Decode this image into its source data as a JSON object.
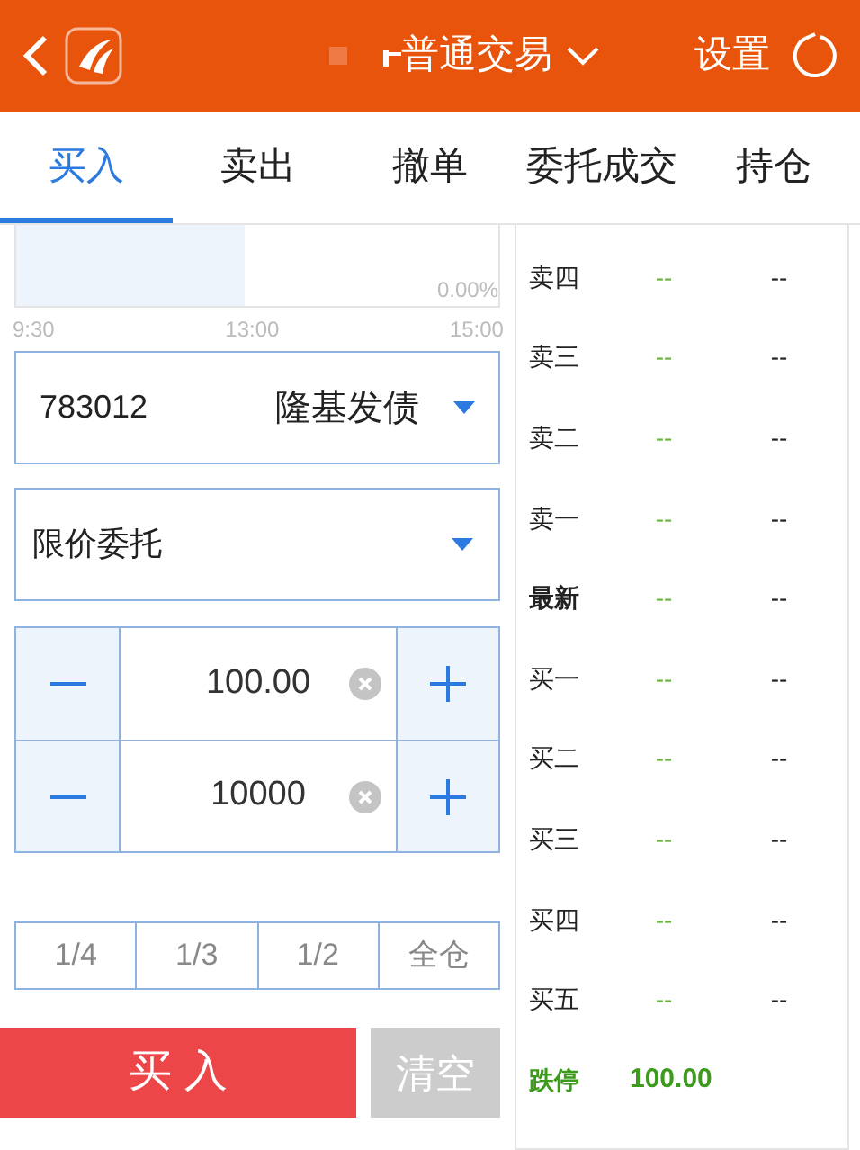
{
  "header": {
    "title": "普通交易",
    "settings": "设置"
  },
  "tabs": [
    {
      "label": "买入",
      "selected": true
    },
    {
      "label": "卖出",
      "selected": false
    },
    {
      "label": "撤单",
      "selected": false
    },
    {
      "label": "委托成交",
      "selected": false
    },
    {
      "label": "持仓",
      "selected": false
    }
  ],
  "chart": {
    "change": "0.00%",
    "times": [
      "9:30",
      "13:00",
      "15:00"
    ]
  },
  "stock": {
    "code": "783012",
    "name": "隆基发债"
  },
  "order_type": "限价委托",
  "price": {
    "value": "100.00"
  },
  "quantity": {
    "value": "10000"
  },
  "ratios": [
    "1/4",
    "1/3",
    "1/2",
    "全仓"
  ],
  "buy_button": "买 入",
  "clear_button": "清空",
  "order_book": [
    {
      "kind": "level",
      "label": "卖四",
      "price": "--",
      "volume": "--"
    },
    {
      "kind": "level",
      "label": "卖三",
      "price": "--",
      "volume": "--"
    },
    {
      "kind": "level",
      "label": "卖二",
      "price": "--",
      "volume": "--"
    },
    {
      "kind": "level",
      "label": "卖一",
      "price": "--",
      "volume": "--"
    },
    {
      "kind": "latest",
      "label": "最新",
      "price": "--",
      "volume": "--"
    },
    {
      "kind": "level",
      "label": "买一",
      "price": "--",
      "volume": "--"
    },
    {
      "kind": "level",
      "label": "买二",
      "price": "--",
      "volume": "--"
    },
    {
      "kind": "level",
      "label": "买三",
      "price": "--",
      "volume": "--"
    },
    {
      "kind": "level",
      "label": "买四",
      "price": "--",
      "volume": "--"
    },
    {
      "kind": "level",
      "label": "买五",
      "price": "--",
      "volume": "--"
    },
    {
      "kind": "limit",
      "label": "跌停",
      "price": "100.00"
    }
  ]
}
